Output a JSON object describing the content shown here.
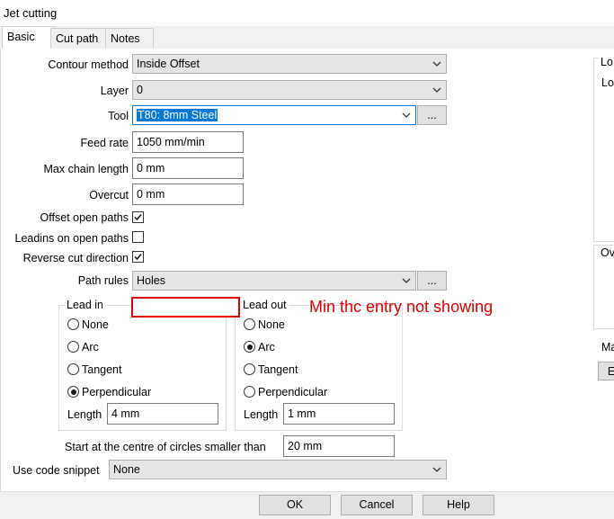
{
  "window": {
    "title": "Jet cutting"
  },
  "tabs": [
    {
      "label": "Basic"
    },
    {
      "label": "Cut path"
    },
    {
      "label": "Notes"
    }
  ],
  "form": {
    "contour_method": {
      "label": "Contour method",
      "value": "Inside Offset"
    },
    "layer": {
      "label": "Layer",
      "value": "0"
    },
    "tool": {
      "label": "Tool",
      "value": "T80: 8mm Steel",
      "browse": "..."
    },
    "feed_rate": {
      "label": "Feed rate",
      "value": "1050 mm/min"
    },
    "max_chain_length": {
      "label": "Max chain length",
      "value": "0 mm"
    },
    "overcut": {
      "label": "Overcut",
      "value": "0 mm"
    },
    "offset_open_paths": {
      "label": "Offset open paths",
      "checked": true
    },
    "leadins_open_paths": {
      "label": "Leadins on open paths",
      "checked": false
    },
    "reverse_cut_direction": {
      "label": "Reverse cut direction",
      "checked": true
    },
    "path_rules": {
      "label": "Path rules",
      "value": "Holes",
      "browse": "..."
    }
  },
  "lead_in": {
    "title": "Lead in",
    "options": [
      "None",
      "Arc",
      "Tangent",
      "Perpendicular"
    ],
    "selected": "Perpendicular",
    "length_label": "Length",
    "length_value": "4 mm"
  },
  "lead_out": {
    "title": "Lead out",
    "options": [
      "None",
      "Arc",
      "Tangent",
      "Perpendicular"
    ],
    "selected": "Arc",
    "length_label": "Length",
    "length_value": "1 mm"
  },
  "circles": {
    "label": "Start at the centre of circles smaller than",
    "value": "20 mm"
  },
  "snippet": {
    "label": "Use code snippet",
    "value": "None"
  },
  "annotation": {
    "text": "Min thc entry not showing"
  },
  "right_panel": {
    "group1": "Lo",
    "row1": "Lo",
    "group2": "Ov",
    "label3": "Ma",
    "btn3": "E"
  },
  "buttons": {
    "ok": "OK",
    "cancel": "Cancel",
    "help": "Help"
  },
  "colors": {
    "selection": "#0078d7",
    "annotation": "#e00000"
  }
}
